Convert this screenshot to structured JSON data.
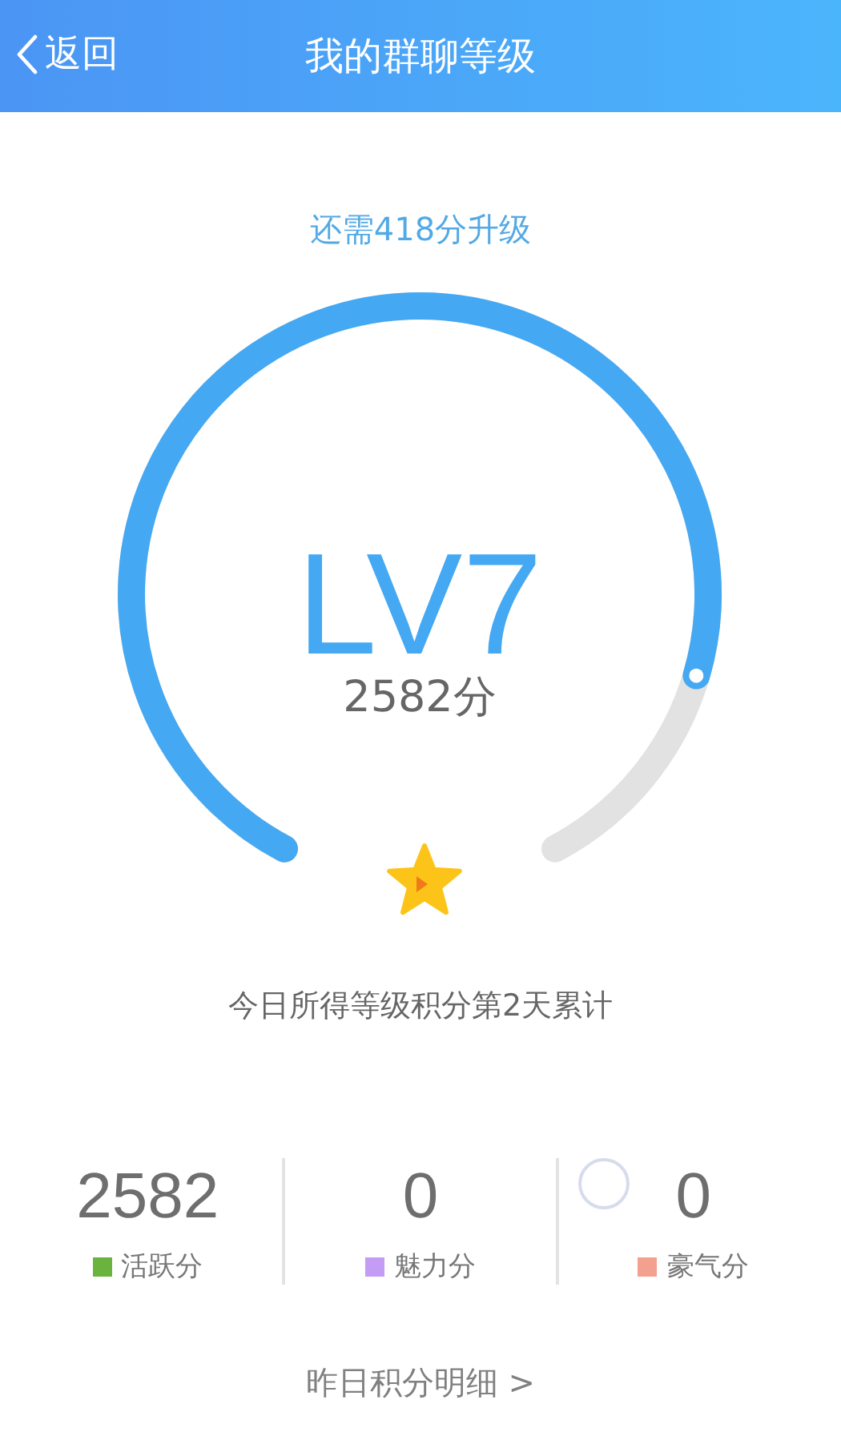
{
  "header": {
    "back": "返回",
    "title": "我的群聊等级"
  },
  "gauge": {
    "hint": "还需418分升级",
    "level_label": "LV7",
    "points": "2582分"
  },
  "note": "今日所得等级积分第2天累计",
  "stats": [
    {
      "value": "2582",
      "label": "活跃分",
      "color": "#6bb33f"
    },
    {
      "value": "0",
      "label": "魅力分",
      "color": "#c59cf5"
    },
    {
      "value": "0",
      "label": "豪气分",
      "color": "#f4a08e"
    }
  ],
  "detail_link": "昨日积分明细 >"
}
